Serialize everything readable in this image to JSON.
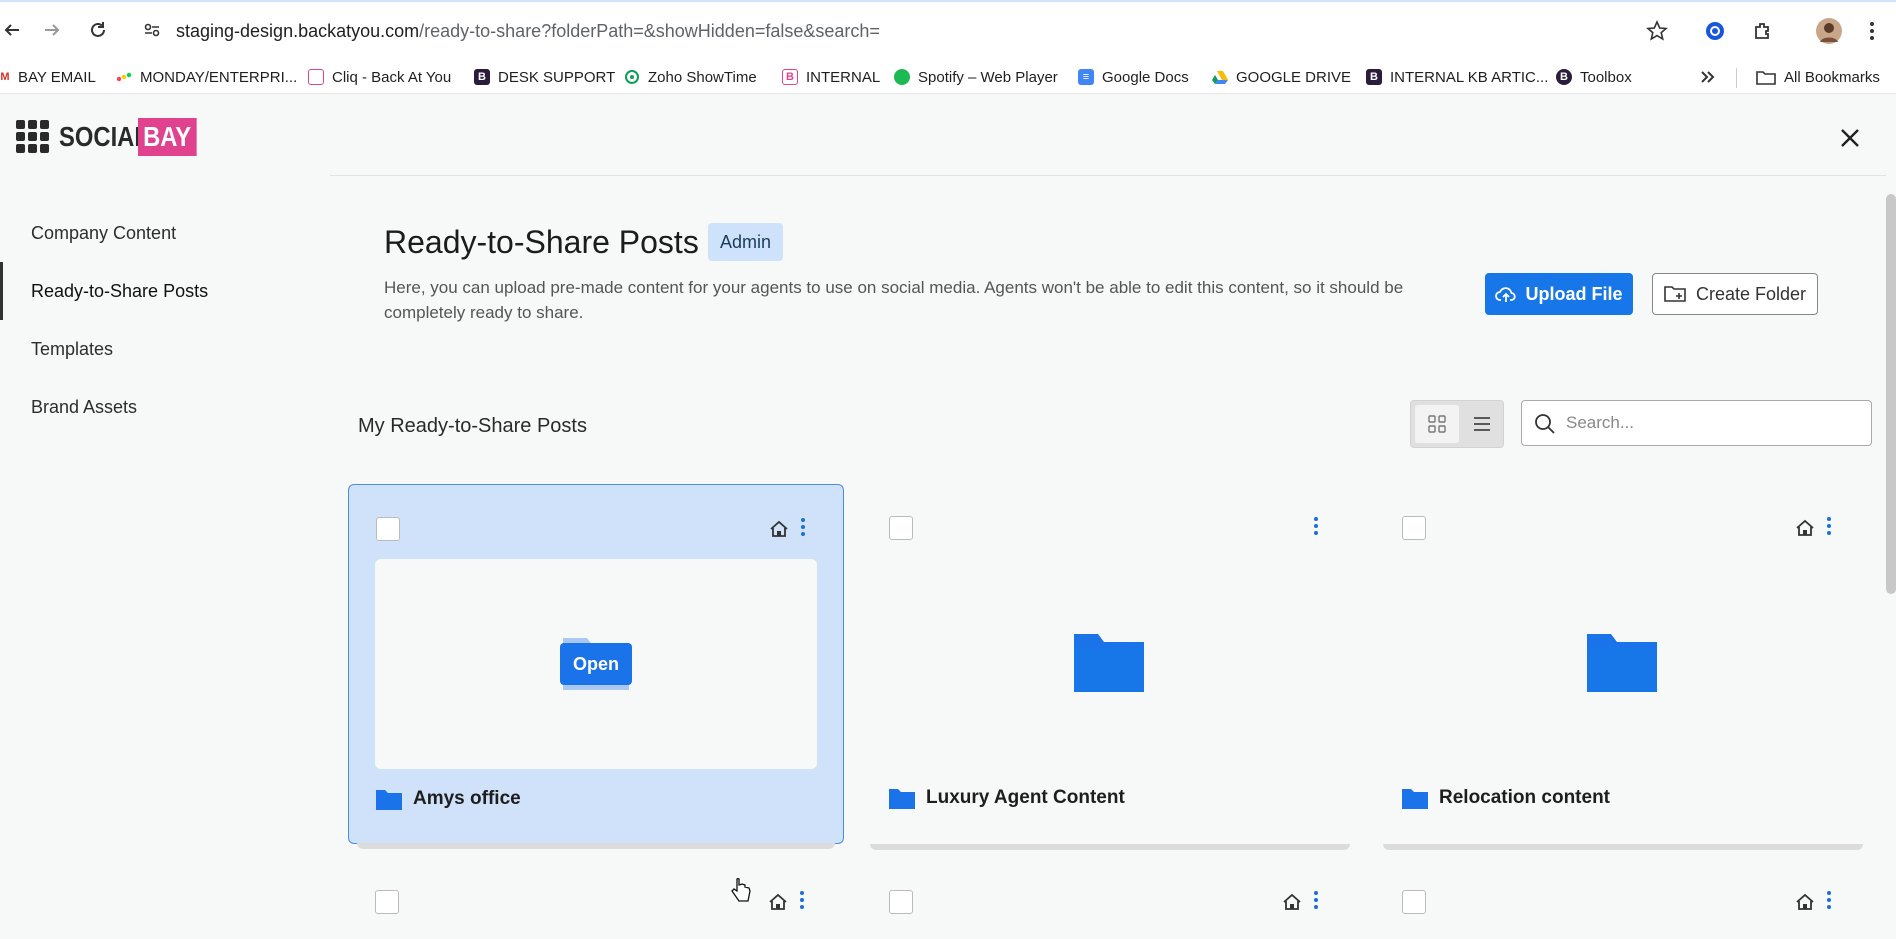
{
  "browser": {
    "url_host": "staging-design.backatyou.com",
    "url_path": "/ready-to-share?folderPath=&showHidden=false&search=",
    "bookmarks": [
      {
        "label": "BAY EMAIL",
        "icon": "gmail-icon",
        "color": "#d93025"
      },
      {
        "label": "MONDAY/ENTERPRI...",
        "icon": "monday-icon",
        "color": "#ff3d57"
      },
      {
        "label": "Cliq - Back At You",
        "icon": "cliq-icon",
        "color": "#e0428e"
      },
      {
        "label": "DESK SUPPORT",
        "icon": "bay-icon",
        "color": "#2b1b3d"
      },
      {
        "label": "Zoho ShowTime",
        "icon": "showtime-icon",
        "color": "#0f9d58"
      },
      {
        "label": "INTERNAL",
        "icon": "bay-icon",
        "color": "#e0428e"
      },
      {
        "label": "Spotify – Web Player",
        "icon": "spotify-icon",
        "color": "#1db954"
      },
      {
        "label": "Google Docs",
        "icon": "docs-icon",
        "color": "#4285f4"
      },
      {
        "label": "GOOGLE  DRIVE",
        "icon": "drive-icon",
        "color": "#fbbc04"
      },
      {
        "label": "INTERNAL KB ARTIC...",
        "icon": "bay-icon",
        "color": "#2b1b3d"
      },
      {
        "label": "Toolbox",
        "icon": "bay-icon",
        "color": "#2b1b3d"
      }
    ],
    "all_bookmarks": "All Bookmarks"
  },
  "app": {
    "logo_social": "SOCIAL",
    "logo_bay": "BAY",
    "sidebar": [
      {
        "label": "Company Content",
        "active": false
      },
      {
        "label": "Ready-to-Share Posts",
        "active": true
      },
      {
        "label": "Templates",
        "active": false
      },
      {
        "label": "Brand Assets",
        "active": false
      }
    ],
    "page_title": "Ready-to-Share Posts",
    "badge": "Admin",
    "description": "Here, you can upload pre-made content for your agents to use on social media. Agents won't be able to edit this content, so it should be completely ready to share.",
    "upload_label": "Upload File",
    "create_label": "Create Folder",
    "section_title": "My Ready-to-Share Posts",
    "search_placeholder": "Search...",
    "open_label": "Open",
    "cards": [
      {
        "name": "Amys office"
      },
      {
        "name": "Luxury Agent Content"
      },
      {
        "name": "Relocation content"
      }
    ],
    "colors": {
      "accent": "#1877e8",
      "brand_pink": "#e0428e",
      "selected_card": "#cfe2fa"
    }
  }
}
